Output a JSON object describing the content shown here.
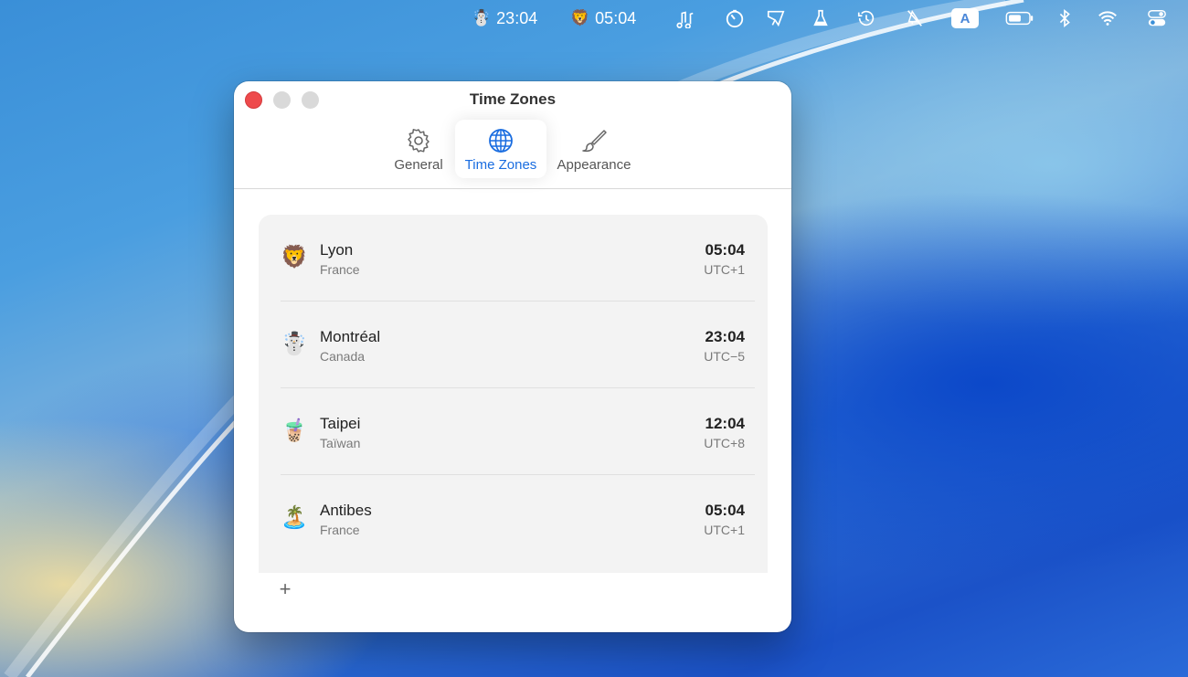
{
  "menubar": {
    "clock1": {
      "emoji": "☃️",
      "time": "23:04"
    },
    "clock2": {
      "emoji": "🦁",
      "time": "05:04"
    },
    "icons": [
      "music-notes-icon",
      "timer-icon",
      "pennant-icon",
      "flask-icon",
      "time-machine-icon",
      "muted-icon",
      "input-source-icon",
      "battery-icon",
      "bluetooth-icon",
      "wifi-icon",
      "control-center-icon"
    ],
    "input_source_label": "A"
  },
  "window": {
    "title": "Time Zones",
    "tabs": [
      {
        "label": "General",
        "icon": "gear-icon"
      },
      {
        "label": "Time Zones",
        "icon": "globe-icon",
        "selected": true
      },
      {
        "label": "Appearance",
        "icon": "paintbrush-icon"
      }
    ],
    "zones": [
      {
        "emoji": "🦁",
        "city": "Lyon",
        "country": "France",
        "time": "05:04",
        "offset": "UTC+1"
      },
      {
        "emoji": "☃️",
        "city": "Montréal",
        "country": "Canada",
        "time": "23:04",
        "offset": "UTC−5"
      },
      {
        "emoji": "🧋",
        "city": "Taipei",
        "country": "Taïwan",
        "time": "12:04",
        "offset": "UTC+8"
      },
      {
        "emoji": "🏝️",
        "city": "Antibes",
        "country": "France",
        "time": "05:04",
        "offset": "UTC+1"
      }
    ],
    "add_label": "+"
  },
  "colors": {
    "accent": "#1a6de0",
    "close": "#ee4a4c"
  }
}
